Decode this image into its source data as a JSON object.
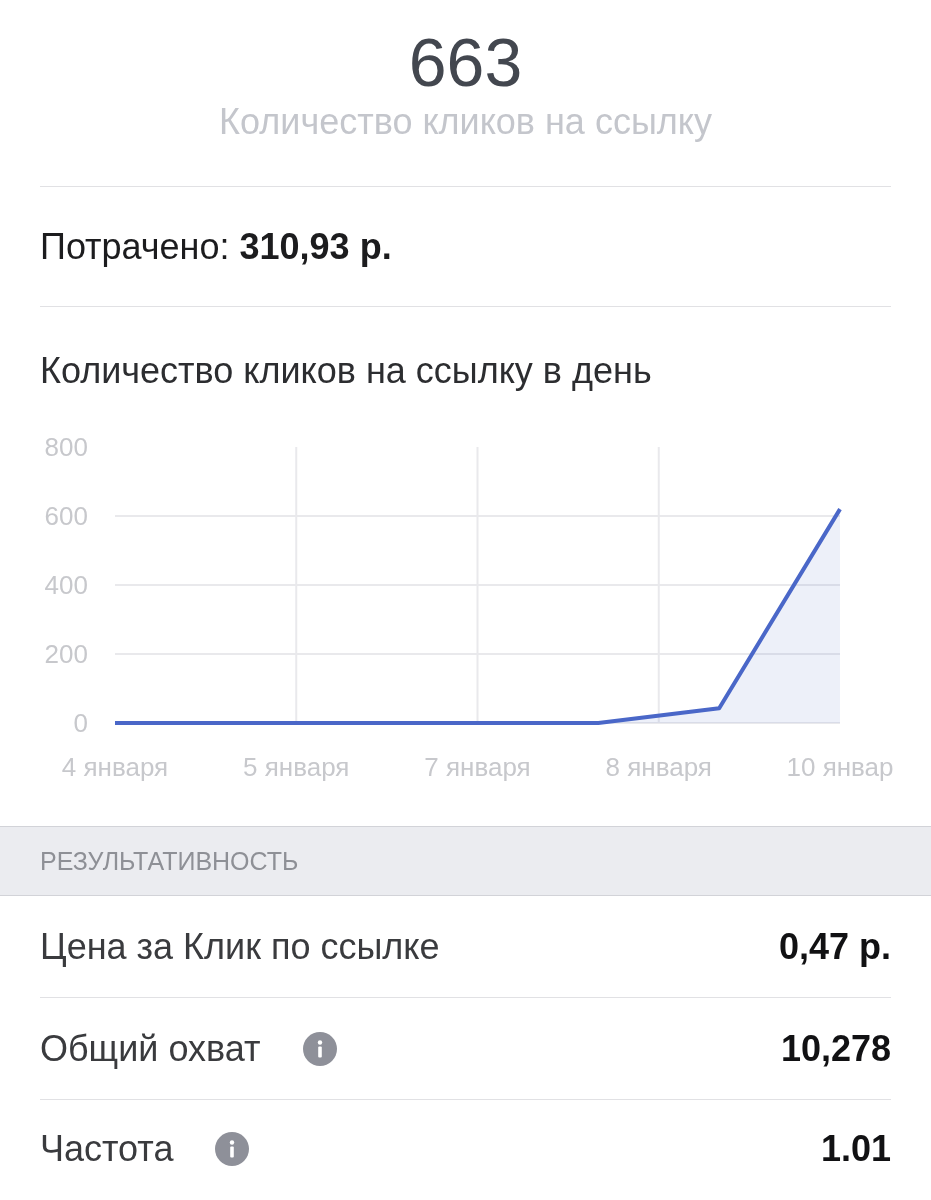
{
  "summary": {
    "value": "663",
    "label": "Количество кликов на ссылку"
  },
  "spent": "Потрачено: **310,93 р.**",
  "chart": {
    "title": "Количество кликов на ссылку в день",
    "chart_data": {
      "type": "area",
      "x": [
        4,
        5,
        6,
        7,
        8,
        9,
        10
      ],
      "series": [
        {
          "color": "#4a67c8",
          "values": [
            0,
            0,
            0,
            0,
            0,
            43,
            620
          ]
        }
      ],
      "xlim": [
        4,
        10
      ],
      "ylim": [
        0,
        800
      ],
      "xticks": [
        {
          "value": 4,
          "label": "4 января"
        },
        {
          "value": 5.5,
          "label": "5 января"
        },
        {
          "value": 7,
          "label": "7 января"
        },
        {
          "value": 8.5,
          "label": "8 января"
        },
        {
          "value": 10,
          "label": "10 январ"
        }
      ],
      "yticks": [
        0,
        200,
        400,
        600,
        800
      ],
      "grid": true
    }
  },
  "section": {
    "title": "РЕЗУЛЬТАТИВНОСТЬ"
  },
  "rows": [
    {
      "label": "Цена за Клик по ссылке",
      "info": false,
      "value": "0,47 р."
    },
    {
      "label": "Общий охват",
      "info": true,
      "value": "10,278"
    },
    {
      "label": "Частота",
      "info": true,
      "value": "1.01"
    }
  ]
}
